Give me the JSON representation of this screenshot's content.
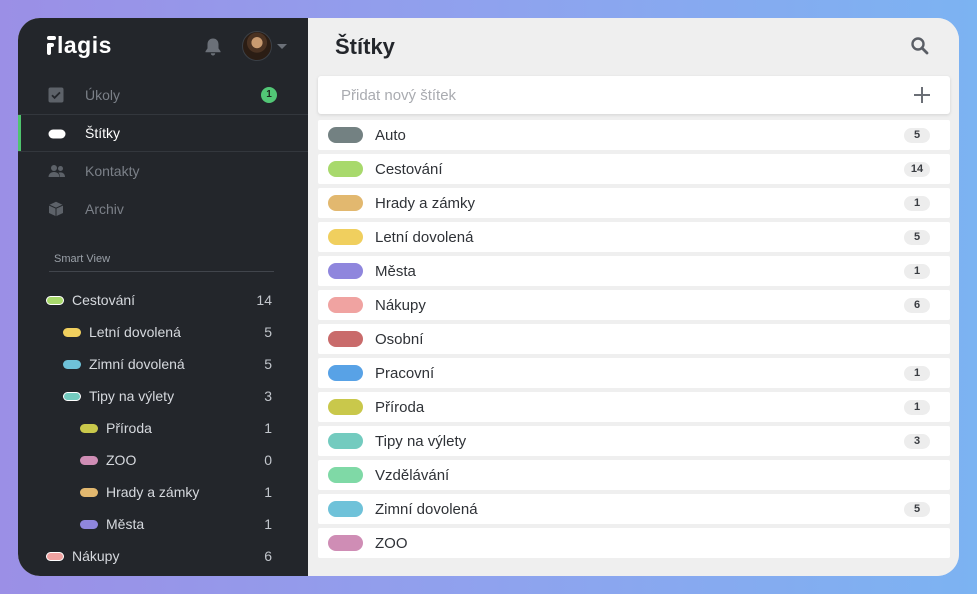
{
  "app": {
    "logo_text": "lagis"
  },
  "sidebar": {
    "nav": [
      {
        "label": "Úkoly",
        "icon": "checkbox-icon",
        "badge": "1"
      },
      {
        "label": "Štítky",
        "icon": "tag-icon",
        "badge": ""
      },
      {
        "label": "Kontakty",
        "icon": "people-icon",
        "badge": ""
      },
      {
        "label": "Archiv",
        "icon": "box-icon",
        "badge": ""
      }
    ],
    "smart_view_title": "Smart View",
    "tree": [
      {
        "label": "Cestování",
        "count": "14",
        "color": "#a8d96c",
        "level": 0,
        "ring": true
      },
      {
        "label": "Letní dovolená",
        "count": "5",
        "color": "#f0cf5e",
        "level": 1,
        "ring": false
      },
      {
        "label": "Zimní dovolená",
        "count": "5",
        "color": "#6fc2d9",
        "level": 1,
        "ring": false
      },
      {
        "label": "Tipy na výlety",
        "count": "3",
        "color": "#73cbbf",
        "level": 1,
        "ring": true
      },
      {
        "label": "Příroda",
        "count": "1",
        "color": "#c9c84b",
        "level": 2,
        "ring": false
      },
      {
        "label": "ZOO",
        "count": "0",
        "color": "#cf8db5",
        "level": 2,
        "ring": false
      },
      {
        "label": "Hrady a zámky",
        "count": "1",
        "color": "#e2b86f",
        "level": 2,
        "ring": false
      },
      {
        "label": "Města",
        "count": "1",
        "color": "#8f86dd",
        "level": 2,
        "ring": false
      },
      {
        "label": "Nákupy",
        "count": "6",
        "color": "#f0a3a1",
        "level": 0,
        "ring": true
      }
    ]
  },
  "main": {
    "title": "Štítky",
    "add_placeholder": "Přidat nový štítek",
    "tags": [
      {
        "name": "Auto",
        "count": "5",
        "color": "#738182"
      },
      {
        "name": "Cestování",
        "count": "14",
        "color": "#a8d96c"
      },
      {
        "name": "Hrady a zámky",
        "count": "1",
        "color": "#e2b86f"
      },
      {
        "name": "Letní dovolená",
        "count": "5",
        "color": "#f0cf5e"
      },
      {
        "name": "Města",
        "count": "1",
        "color": "#8f86dd"
      },
      {
        "name": "Nákupy",
        "count": "6",
        "color": "#f0a3a1"
      },
      {
        "name": "Osobní",
        "count": "",
        "color": "#c96b6b"
      },
      {
        "name": "Pracovní",
        "count": "1",
        "color": "#58a2e6"
      },
      {
        "name": "Příroda",
        "count": "1",
        "color": "#c9c84b"
      },
      {
        "name": "Tipy na výlety",
        "count": "3",
        "color": "#73cbbf"
      },
      {
        "name": "Vzdělávání",
        "count": "",
        "color": "#7fd9a6"
      },
      {
        "name": "Zimní dovolená",
        "count": "5",
        "color": "#6fc2d9"
      },
      {
        "name": "ZOO",
        "count": "",
        "color": "#cf8db5"
      }
    ]
  }
}
